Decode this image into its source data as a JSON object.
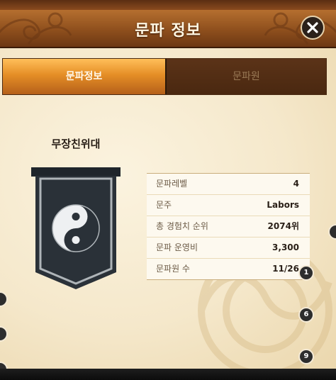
{
  "header": {
    "title": "문파 정보"
  },
  "tabs": [
    {
      "label": "문파정보",
      "active": true
    },
    {
      "label": "문파원",
      "active": false
    }
  ],
  "guild": {
    "name": "무장친위대",
    "emblem": "yin-yang-banner-icon",
    "info": [
      {
        "label": "문파레벨",
        "value": "4"
      },
      {
        "label": "문주",
        "value": "Labors"
      },
      {
        "label": "총 경험치 순위",
        "value": "2074위"
      },
      {
        "label": "문파 운영비",
        "value": "3,300"
      },
      {
        "label": "문파원 수",
        "value": "11/26"
      }
    ]
  },
  "markers": [
    "1",
    "6",
    "9"
  ],
  "colors": {
    "header": "#8e4f1d",
    "tab_active": "#e58e26",
    "tab_inactive": "#4a2810",
    "parchment": "#f5e8cb",
    "banner": "#2a3138"
  }
}
